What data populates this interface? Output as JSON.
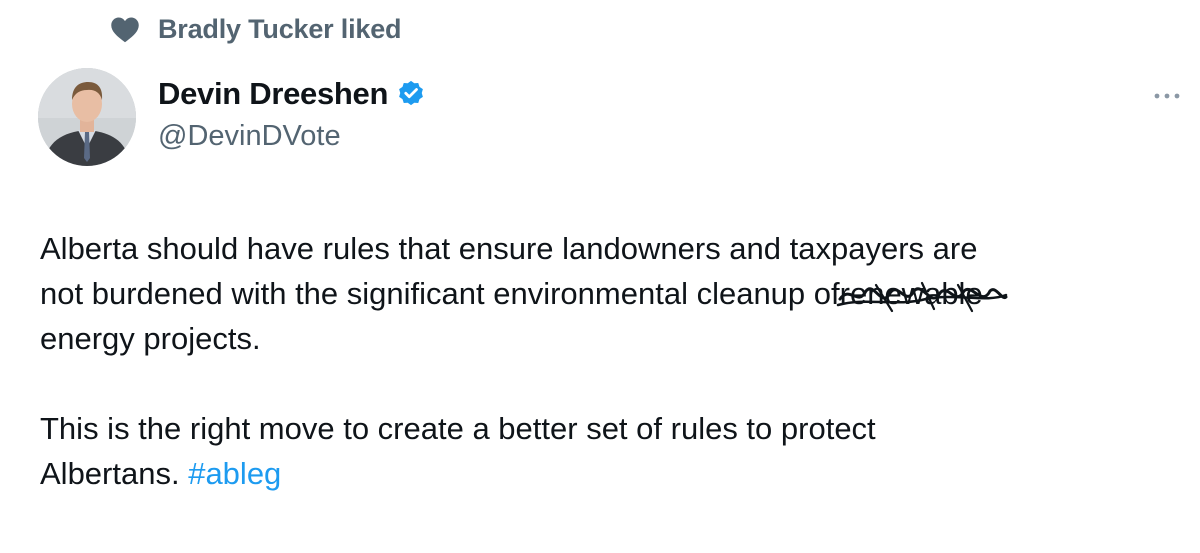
{
  "social_context": {
    "icon": "heart-icon",
    "text": "Bradly Tucker liked"
  },
  "author": {
    "name": "Devin Dreeshen",
    "handle": "@DevinDVote",
    "verified_icon": "verified-badge-icon",
    "avatar_icon": "avatar"
  },
  "tweet": {
    "para1_line1": "Alberta should have rules that ensure landowners and taxpayers are",
    "para1_line2_before": "not burdened with the significant environmental cleanup of",
    "para1_line2_scribbled": "renewable",
    "para1_line3": "energy projects.",
    "para2_line1": "This is the right move to create a better set of rules to protect",
    "para2_line2_before": "Albertans.",
    "hashtag": "#ableg"
  },
  "colors": {
    "text": "#0f1419",
    "secondary": "#536471",
    "link": "#1d9bf0",
    "verified": "#1d9bf0"
  },
  "more_icon": "more-options-icon"
}
